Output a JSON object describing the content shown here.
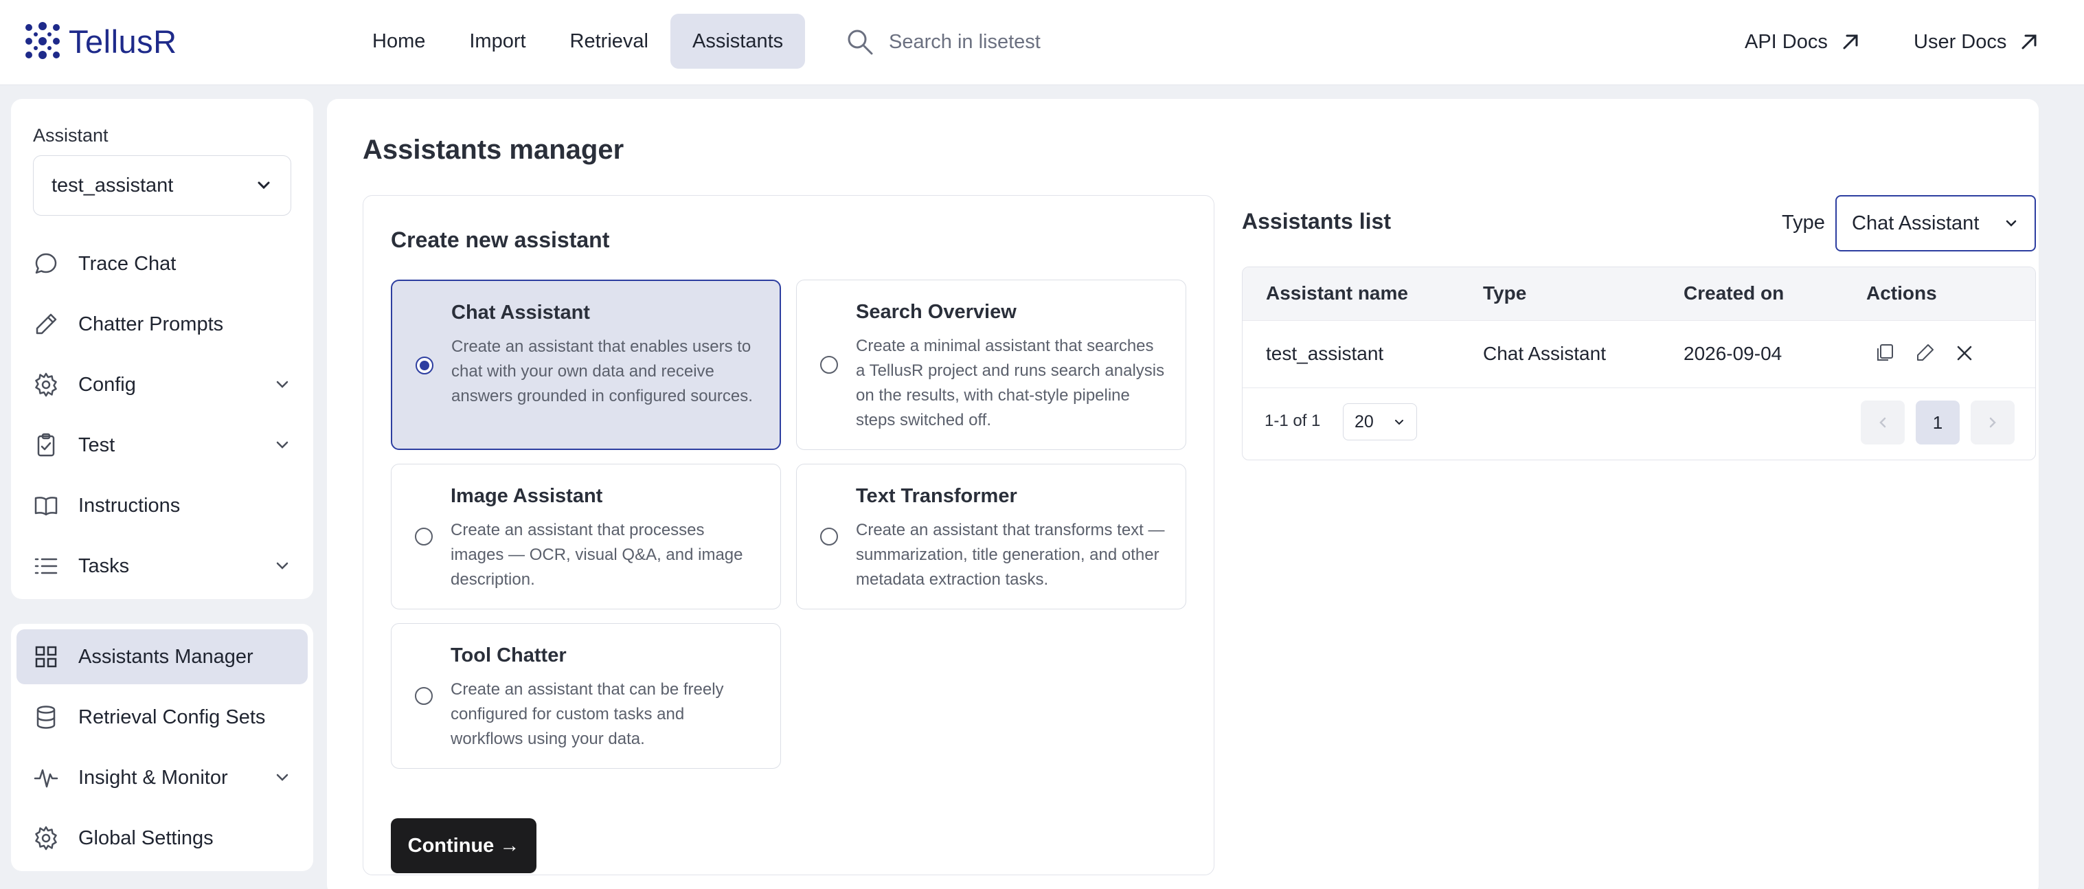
{
  "brand": {
    "name": "TellusR"
  },
  "nav": {
    "items": [
      "Home",
      "Import",
      "Retrieval",
      "Assistants"
    ],
    "active": "Assistants"
  },
  "search": {
    "placeholder": "Search in lisetest"
  },
  "header_links": {
    "api_docs": "API Docs",
    "user_docs": "User Docs"
  },
  "sidebar": {
    "assistant_label": "Assistant",
    "assistant_value": "test_assistant",
    "top_items": [
      {
        "label": "Trace Chat",
        "icon": "chat-bubble-icon",
        "expandable": false
      },
      {
        "label": "Chatter Prompts",
        "icon": "pencil-icon",
        "expandable": false
      },
      {
        "label": "Config",
        "icon": "gear-icon",
        "expandable": true
      },
      {
        "label": "Test",
        "icon": "clipboard-icon",
        "expandable": true
      },
      {
        "label": "Instructions",
        "icon": "book-icon",
        "expandable": false
      },
      {
        "label": "Tasks",
        "icon": "list-icon",
        "expandable": true
      }
    ],
    "bottom_items": [
      {
        "label": "Assistants Manager",
        "icon": "grid-icon",
        "expandable": false,
        "active": true
      },
      {
        "label": "Retrieval Config Sets",
        "icon": "database-icon",
        "expandable": false
      },
      {
        "label": "Insight & Monitor",
        "icon": "pulse-icon",
        "expandable": true
      },
      {
        "label": "Global Settings",
        "icon": "gear-icon",
        "expandable": false
      }
    ]
  },
  "main": {
    "title": "Assistants manager",
    "create": {
      "title": "Create new assistant",
      "options": [
        {
          "title": "Chat Assistant",
          "description": "Create an assistant that enables users to chat with your own data and receive answers grounded in configured sources.",
          "selected": true
        },
        {
          "title": "Search Overview",
          "description": "Create a minimal assistant that searches a TellusR project and runs search analysis on the results, with chat-style pipeline steps switched off.",
          "selected": false
        },
        {
          "title": "Image Assistant",
          "description": "Create an assistant that processes images — OCR, visual Q&A, and image description.",
          "selected": false
        },
        {
          "title": "Text Transformer",
          "description": "Create an assistant that transforms text — summarization, title generation, and other metadata extraction tasks.",
          "selected": false
        },
        {
          "title": "Tool Chatter",
          "description": "Create an assistant that can be freely configured for custom tasks and workflows using your data.",
          "selected": false
        }
      ],
      "continue_label": "Continue →"
    },
    "list": {
      "title": "Assistants list",
      "type_label": "Type",
      "type_value": "Chat Assistant",
      "columns": [
        "Assistant name",
        "Type",
        "Created on",
        "Actions"
      ],
      "rows": [
        {
          "name": "test_assistant",
          "type": "Chat Assistant",
          "created": "2026-09-04"
        }
      ],
      "actions": [
        "copy-icon",
        "edit-icon",
        "delete-icon"
      ],
      "pagination": {
        "range_text": "1-1 of 1",
        "page_size": "20",
        "current_page": "1"
      }
    }
  },
  "colors": {
    "accent": "#2d3ea0",
    "selected_bg": "#dfe2ee",
    "brand": "#1e2a8a",
    "button_dark": "#1c1c1e"
  }
}
